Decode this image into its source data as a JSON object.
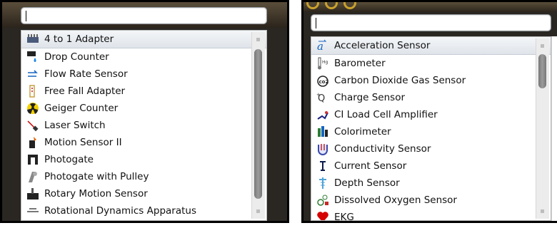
{
  "left": {
    "search_value": "",
    "items": [
      {
        "label": "4 to 1 Adapter",
        "icon": "adapter-icon"
      },
      {
        "label": "Drop Counter",
        "icon": "drop-counter-icon"
      },
      {
        "label": "Flow Rate Sensor",
        "icon": "flow-rate-icon"
      },
      {
        "label": "Free Fall Adapter",
        "icon": "free-fall-icon"
      },
      {
        "label": "Geiger Counter",
        "icon": "radiation-icon"
      },
      {
        "label": "Laser Switch",
        "icon": "laser-icon"
      },
      {
        "label": "Motion Sensor II",
        "icon": "motion-sensor-icon"
      },
      {
        "label": "Photogate",
        "icon": "photogate-icon"
      },
      {
        "label": "Photogate with Pulley",
        "icon": "pulley-icon"
      },
      {
        "label": "Rotary Motion Sensor",
        "icon": "rotary-icon"
      },
      {
        "label": "Rotational Dynamics Apparatus",
        "icon": "apparatus-icon"
      }
    ]
  },
  "right": {
    "search_value": "",
    "items": [
      {
        "label": "Acceleration Sensor",
        "icon": "acceleration-icon"
      },
      {
        "label": "Barometer",
        "icon": "barometer-icon"
      },
      {
        "label": "Carbon Dioxide Gas Sensor",
        "icon": "co2-icon"
      },
      {
        "label": "Charge Sensor",
        "icon": "charge-icon"
      },
      {
        "label": "CI Load Cell Amplifier",
        "icon": "load-cell-icon"
      },
      {
        "label": "Colorimeter",
        "icon": "colorimeter-icon"
      },
      {
        "label": "Conductivity Sensor",
        "icon": "conductivity-icon"
      },
      {
        "label": "Current Sensor",
        "icon": "current-icon"
      },
      {
        "label": "Depth Sensor",
        "icon": "depth-icon"
      },
      {
        "label": "Dissolved Oxygen Sensor",
        "icon": "dissolved-oxygen-icon"
      },
      {
        "label": "EKG",
        "icon": "heart-icon"
      }
    ]
  }
}
